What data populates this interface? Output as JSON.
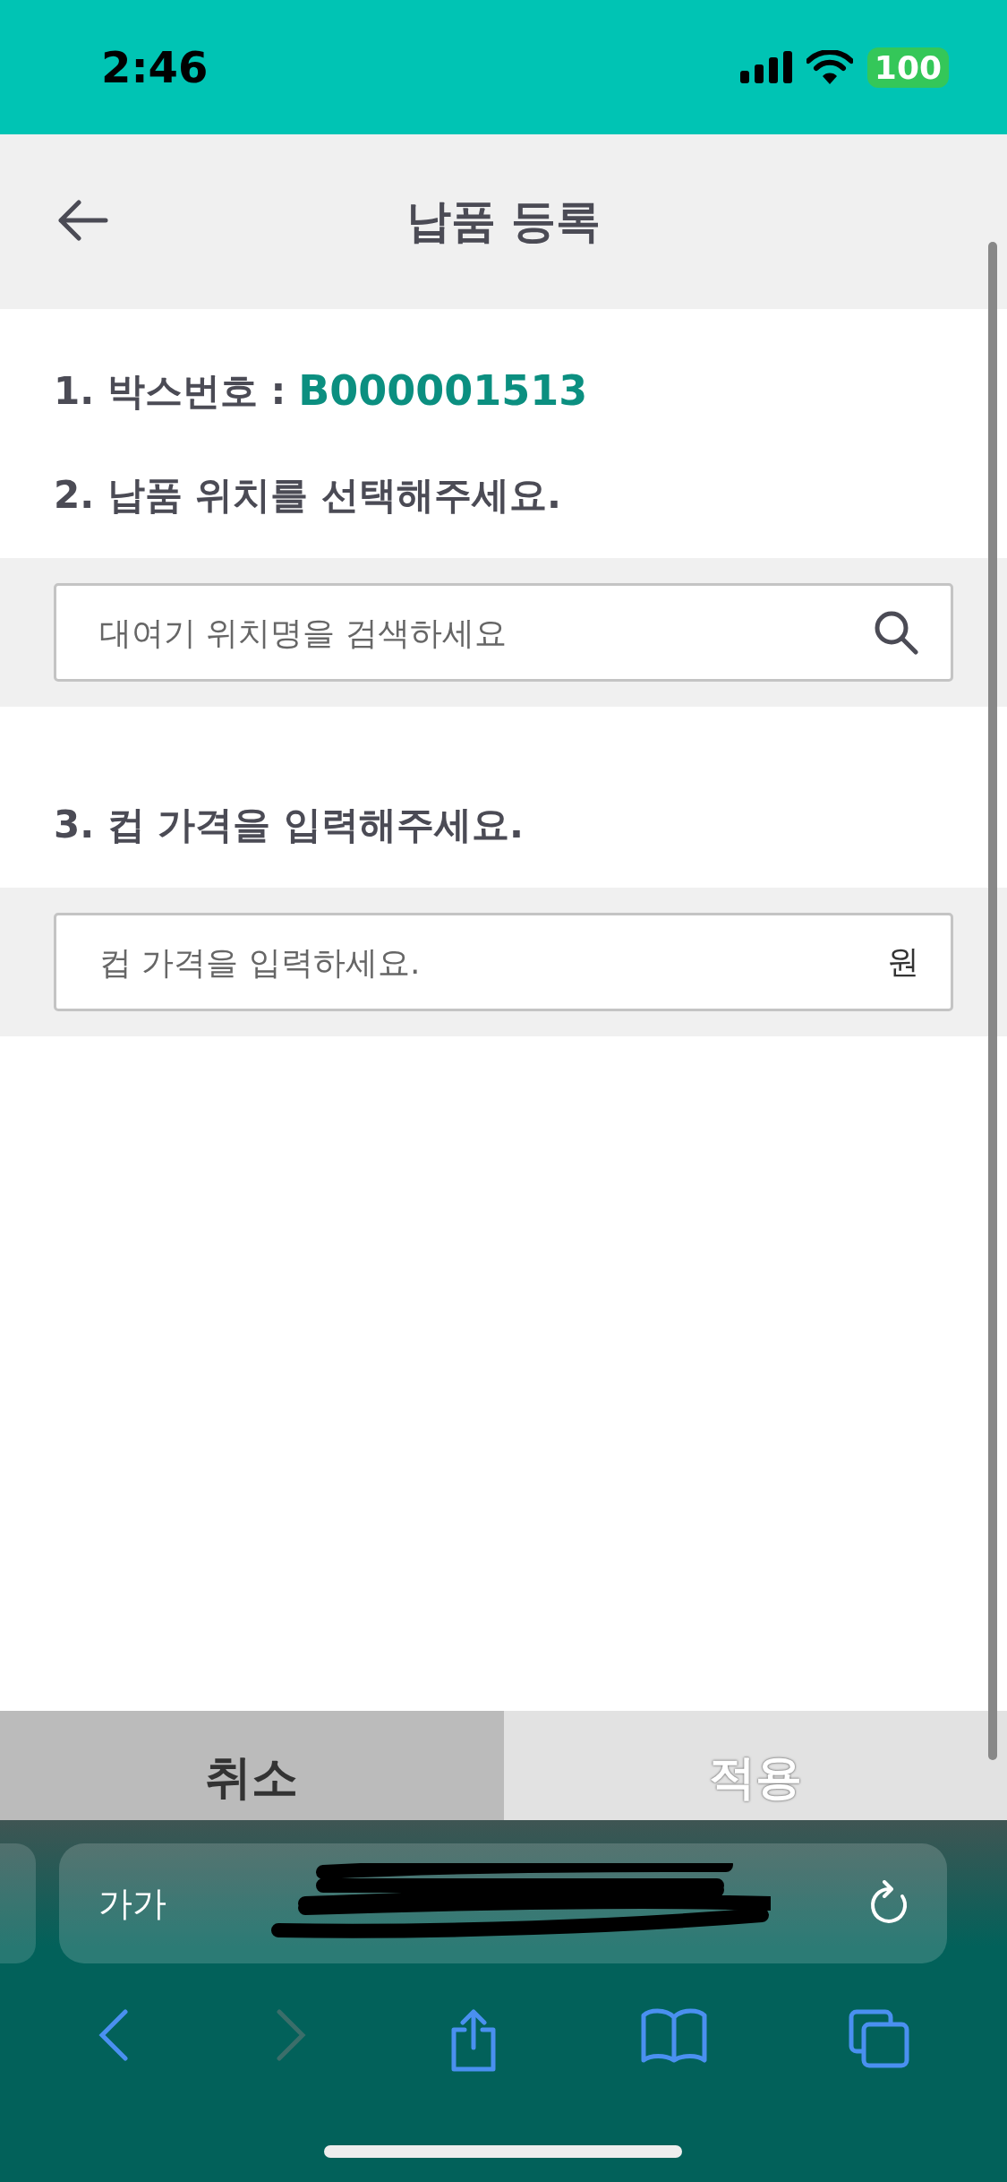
{
  "status_bar": {
    "time": "2:46",
    "battery": "100"
  },
  "header": {
    "title": "납품 등록"
  },
  "form": {
    "box_number": {
      "label": "1. 박스번호 :",
      "value": "B000001513"
    },
    "location": {
      "label": "2. 납품 위치를 선택해주세요.",
      "placeholder": "대여기 위치명을 검색하세요"
    },
    "price": {
      "label": "3. 컵 가격을 입력해주세요.",
      "placeholder": "컵 가격을 입력하세요.",
      "unit": "원"
    }
  },
  "buttons": [
    {
      "label": "취소",
      "kind": "cancel"
    },
    {
      "label": "적용",
      "kind": "apply"
    }
  ],
  "browser": {
    "text_size_button": "가가"
  }
}
